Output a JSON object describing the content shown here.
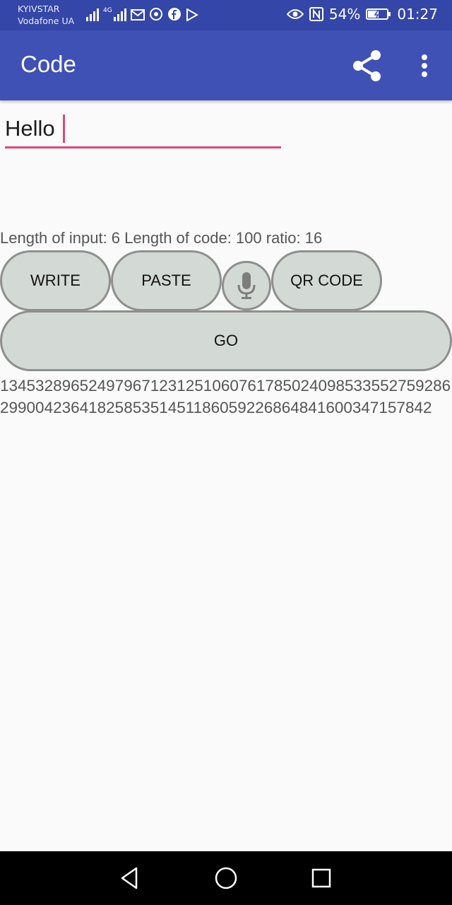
{
  "status_bar": {
    "carrier1": "KYIVSTAR",
    "carrier2": "Vodafone UA",
    "network_label": "4G",
    "battery": "54%",
    "time": "01:27"
  },
  "app_bar": {
    "title": "Code",
    "icons": [
      "share-icon",
      "more-vert-icon"
    ]
  },
  "input": {
    "value": "Hello"
  },
  "info_text": "Length of input: 6 Length of code: 100 ratio: 16",
  "buttons": {
    "write": "WRITE",
    "paste": "PASTE",
    "qr_code": "QR CODE",
    "go": "GO"
  },
  "code_output": "1345328965249796712312510607617850240985335527592862990042364182585351451186059226864841600347157842",
  "colors": {
    "status_bar": "#3446a8",
    "app_bar": "#3f51b5",
    "accent": "#e0457b",
    "button_fill": "#d3d9d5",
    "button_border": "#8f8f8f"
  }
}
